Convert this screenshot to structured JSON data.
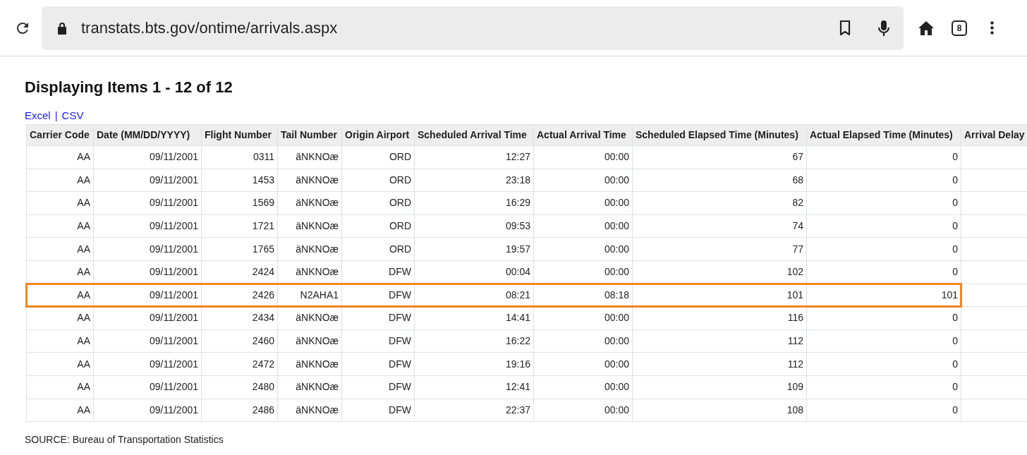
{
  "browser": {
    "url": "transtats.bts.gov/ontime/arrivals.aspx",
    "tab_count": "8"
  },
  "heading": "Displaying Items 1 - 12 of 12",
  "export_links": [
    "Excel",
    "CSV"
  ],
  "export_separator": "|",
  "table": {
    "columns": [
      "Carrier Code",
      "Date (MM/DD/YYYY)",
      "Flight Number",
      "Tail Number",
      "Origin Airport",
      "Scheduled Arrival Time",
      "Actual Arrival Time",
      "Scheduled Elapsed Time (Minutes)",
      "Actual Elapsed Time (Minutes)",
      "Arrival Delay"
    ],
    "rows": [
      {
        "cells": [
          "AA",
          "09/11/2001",
          "0311",
          "äNKNOæ",
          "ORD",
          "12:27",
          "00:00",
          "67",
          "0"
        ],
        "highlighted": false
      },
      {
        "cells": [
          "AA",
          "09/11/2001",
          "1453",
          "äNKNOæ",
          "ORD",
          "23:18",
          "00:00",
          "68",
          "0"
        ],
        "highlighted": false
      },
      {
        "cells": [
          "AA",
          "09/11/2001",
          "1569",
          "äNKNOæ",
          "ORD",
          "16:29",
          "00:00",
          "82",
          "0"
        ],
        "highlighted": false
      },
      {
        "cells": [
          "AA",
          "09/11/2001",
          "1721",
          "äNKNOæ",
          "ORD",
          "09:53",
          "00:00",
          "74",
          "0"
        ],
        "highlighted": false
      },
      {
        "cells": [
          "AA",
          "09/11/2001",
          "1765",
          "äNKNOæ",
          "ORD",
          "19:57",
          "00:00",
          "77",
          "0"
        ],
        "highlighted": false
      },
      {
        "cells": [
          "AA",
          "09/11/2001",
          "2424",
          "äNKNOæ",
          "DFW",
          "00:04",
          "00:00",
          "102",
          "0"
        ],
        "highlighted": false
      },
      {
        "cells": [
          "AA",
          "09/11/2001",
          "2426",
          "N2AHA1",
          "DFW",
          "08:21",
          "08:18",
          "101",
          "101"
        ],
        "highlighted": true
      },
      {
        "cells": [
          "AA",
          "09/11/2001",
          "2434",
          "äNKNOæ",
          "DFW",
          "14:41",
          "00:00",
          "116",
          "0"
        ],
        "highlighted": false
      },
      {
        "cells": [
          "AA",
          "09/11/2001",
          "2460",
          "äNKNOæ",
          "DFW",
          "16:22",
          "00:00",
          "112",
          "0"
        ],
        "highlighted": false
      },
      {
        "cells": [
          "AA",
          "09/11/2001",
          "2472",
          "äNKNOæ",
          "DFW",
          "19:16",
          "00:00",
          "112",
          "0"
        ],
        "highlighted": false
      },
      {
        "cells": [
          "AA",
          "09/11/2001",
          "2480",
          "äNKNOæ",
          "DFW",
          "12:41",
          "00:00",
          "109",
          "0"
        ],
        "highlighted": false
      },
      {
        "cells": [
          "AA",
          "09/11/2001",
          "2486",
          "äNKNOæ",
          "DFW",
          "22:37",
          "00:00",
          "108",
          "0"
        ],
        "highlighted": false
      }
    ]
  },
  "source_note": "SOURCE: Bureau of Transportation Statistics"
}
